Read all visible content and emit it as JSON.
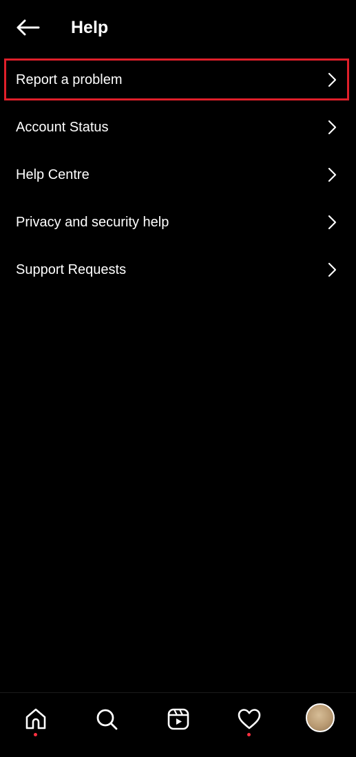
{
  "header": {
    "title": "Help",
    "back_icon": "arrow-left-icon"
  },
  "menu": {
    "items": [
      {
        "label": "Report a problem",
        "icon": "chevron-right-icon",
        "highlighted": true
      },
      {
        "label": "Account Status",
        "icon": "chevron-right-icon"
      },
      {
        "label": "Help Centre",
        "icon": "chevron-right-icon"
      },
      {
        "label": "Privacy and security help",
        "icon": "chevron-right-icon"
      },
      {
        "label": "Support Requests",
        "icon": "chevron-right-icon"
      }
    ]
  },
  "bottom_nav": {
    "items": [
      {
        "icon": "home-icon",
        "notification_dot": true
      },
      {
        "icon": "search-icon",
        "notification_dot": false
      },
      {
        "icon": "reels-icon",
        "notification_dot": false
      },
      {
        "icon": "heart-icon",
        "notification_dot": true
      },
      {
        "icon": "profile-avatar",
        "notification_dot": false
      }
    ]
  },
  "colors": {
    "background": "#000000",
    "text": "#ffffff",
    "highlight_border": "#e01f2a",
    "notification_dot": "#ff3040"
  }
}
